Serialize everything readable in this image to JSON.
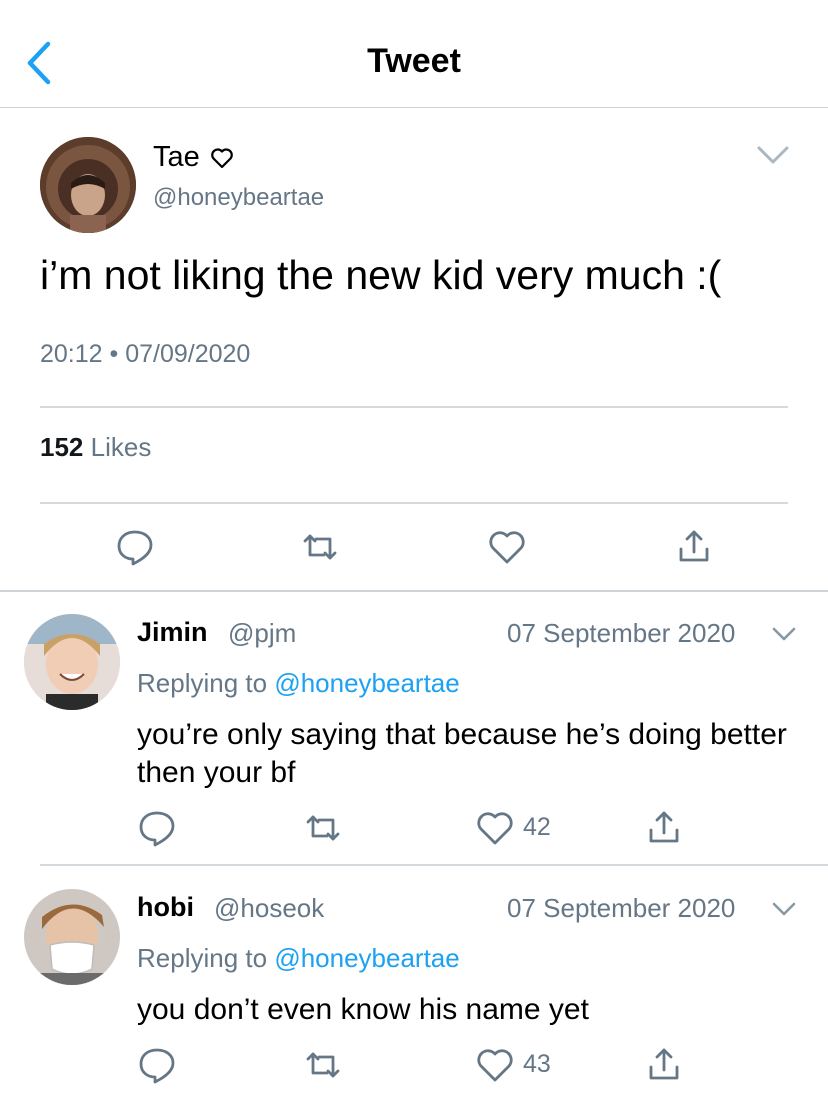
{
  "nav": {
    "title": "Tweet",
    "back_icon": "chevron-left-icon",
    "accent": "#1da1f2"
  },
  "tweet": {
    "name": "Tae",
    "name_icon": "heart-outline-icon",
    "handle": "@honeybeartae",
    "text": "i’m not liking the new kid very much :(",
    "timestamp": "20:12 • 07/09/2020",
    "likes_count": "152",
    "likes_label": "Likes",
    "actions": [
      "reply-icon",
      "retweet-icon",
      "like-icon",
      "share-icon"
    ]
  },
  "replies": [
    {
      "name": "Jimin",
      "handle": "@pjm",
      "date": "07 September 2020",
      "replying_prefix": "Replying to",
      "replying_to": "@honeybeartae",
      "text": "you’re only saying that because he’s doing better then your bf",
      "like_count": "42"
    },
    {
      "name": "hobi",
      "handle": "@hoseok",
      "date": "07 September 2020",
      "replying_prefix": "Replying to",
      "replying_to": "@honeybeartae",
      "text": "you don’t even know his name yet",
      "like_count": "43"
    }
  ]
}
